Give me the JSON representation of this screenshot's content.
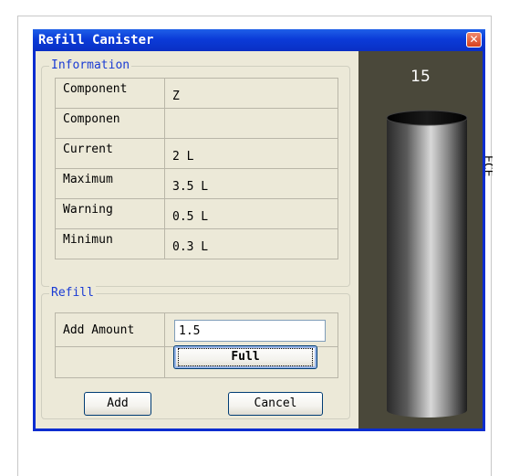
{
  "background": {
    "fragment_text": "ECE"
  },
  "dialog": {
    "title": "Refill Canister",
    "close_glyph": "✕",
    "colors": {
      "title_bar": "#0a2dd0",
      "body": "#ece9d8",
      "legend_text": "#1a3bd4",
      "visual_panel": "#4a483a"
    }
  },
  "information": {
    "legend": "Information",
    "rows": [
      {
        "label": "Component",
        "value": "Z"
      },
      {
        "label": "Componen",
        "value": ""
      },
      {
        "label": "Current",
        "value": "2 L"
      },
      {
        "label": "Maximum",
        "value": "3.5 L"
      },
      {
        "label": "Warning",
        "value": "0.5 L"
      },
      {
        "label": "Minimun",
        "value": "0.3 L"
      }
    ]
  },
  "refill": {
    "legend": "Refill",
    "add_amount_label": "Add Amount",
    "add_amount_value": "1.5",
    "full_button": "Full",
    "add_button": "Add",
    "cancel_button": "Cancel"
  },
  "visual": {
    "level_label": "15",
    "icon": "canister-cylinder-icon"
  }
}
